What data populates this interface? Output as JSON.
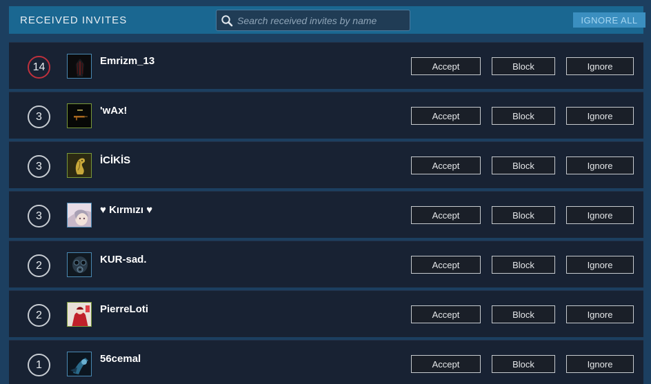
{
  "header": {
    "title": "RECEIVED INVITES",
    "search_placeholder": "Search received invites by name",
    "ignore_all_label": "IGNORE ALL"
  },
  "colors": {
    "header_bg": "#1a6791",
    "row_bg": "#182233",
    "hot_ring": "#c0313d"
  },
  "invites": [
    {
      "count": "14",
      "name": "Emrizm_13",
      "hot": true,
      "avatar_icon": "dark-figure-avatar"
    },
    {
      "count": "3",
      "name": "'wAx!",
      "hot": false,
      "avatar_icon": "rifle-avatar"
    },
    {
      "count": "3",
      "name": "İCİKİS",
      "hot": false,
      "avatar_icon": "golden-seahorse-avatar"
    },
    {
      "count": "3",
      "name": "♥ Kırmızı ♥",
      "hot": false,
      "avatar_icon": "anime-girl-avatar"
    },
    {
      "count": "2",
      "name": "KUR-sad.",
      "hot": false,
      "avatar_icon": "gas-mask-avatar"
    },
    {
      "count": "2",
      "name": "PierreLoti",
      "hot": false,
      "avatar_icon": "red-character-avatar"
    },
    {
      "count": "1",
      "name": "56cemal",
      "hot": false,
      "avatar_icon": "blue-figure-avatar"
    }
  ],
  "row_actions": {
    "accept": "Accept",
    "block": "Block",
    "ignore": "Ignore"
  }
}
